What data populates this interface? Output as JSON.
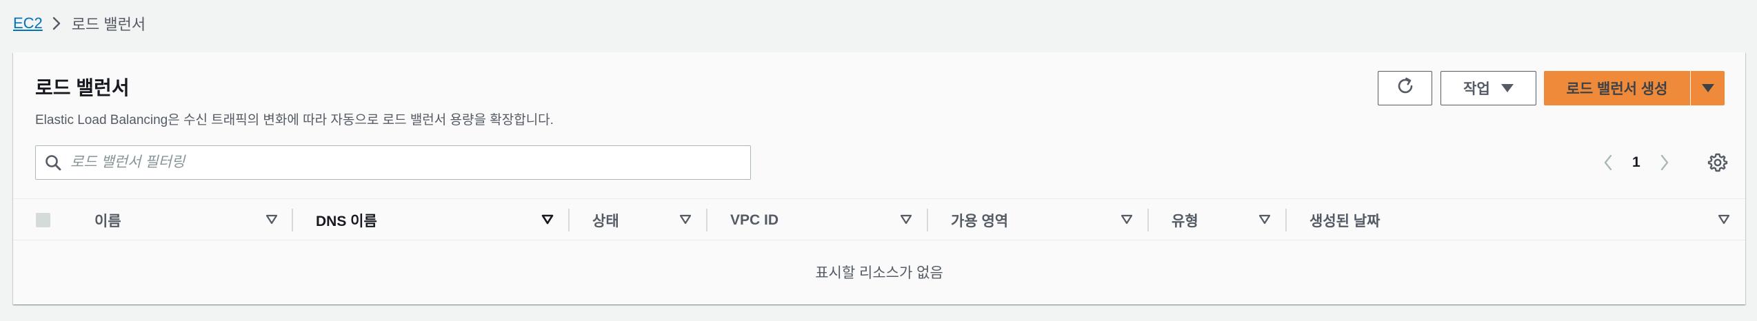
{
  "breadcrumb": {
    "root": "EC2",
    "current": "로드 밸런서"
  },
  "header": {
    "title": "로드 밸런서",
    "description": "Elastic Load Balancing은 수신 트래픽의 변화에 따라 자동으로 로드 밸런서 용량을 확장합니다.",
    "action_label": "작업",
    "create_label": "로드 밸런서 생성"
  },
  "search": {
    "placeholder": "로드 밸런서 필터링",
    "value": ""
  },
  "pagination": {
    "current_page": "1"
  },
  "table": {
    "columns": [
      "이름",
      "DNS 이름",
      "상태",
      "VPC ID",
      "가용 영역",
      "유형",
      "생성된 날짜"
    ],
    "active_sort_column": "DNS 이름",
    "empty_message": "표시할 리소스가 없음"
  },
  "colors": {
    "link": "#0073bb",
    "primary": "#ec7211",
    "background": "#f2f3f3",
    "panel": "#fafafa"
  },
  "icons": {
    "breadcrumb_separator": "chevron-right-icon",
    "refresh": "refresh-icon",
    "action_dropdown": "caret-down-icon",
    "search": "search-icon",
    "prev": "chevron-left-icon",
    "next": "chevron-right-icon",
    "settings": "gear-icon",
    "sort": "sort-caret-icon"
  }
}
